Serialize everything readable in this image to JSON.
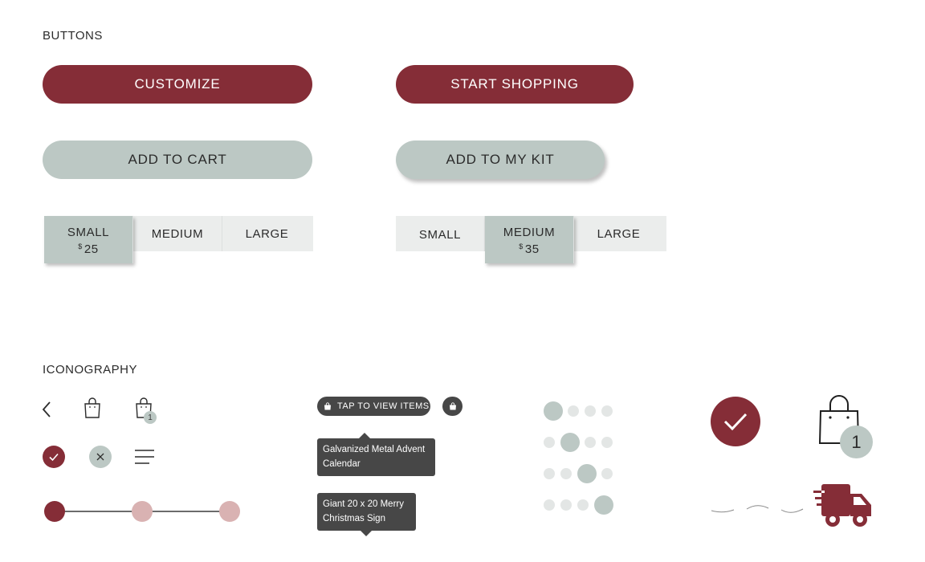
{
  "sections": {
    "buttons_title": "BUTTONS",
    "icons_title": "ICONOGRAPHY"
  },
  "buttons": {
    "customize": "CUSTOMIZE",
    "start_shopping": "START SHOPPING",
    "add_to_cart": "ADD TO CART",
    "add_to_my_kit": "ADD TO MY KIT"
  },
  "size_selector_a": {
    "options": [
      {
        "label": "SMALL",
        "currency": "$",
        "price": "25",
        "selected": true
      },
      {
        "label": "MEDIUM",
        "selected": false
      },
      {
        "label": "LARGE",
        "selected": false
      }
    ]
  },
  "size_selector_b": {
    "options": [
      {
        "label": "SMALL",
        "selected": false
      },
      {
        "label": "MEDIUM",
        "currency": "$",
        "price": "35",
        "selected": true
      },
      {
        "label": "LARGE",
        "selected": false
      }
    ]
  },
  "icons": {
    "bag_badge_small": "1",
    "bag_badge_large": "1",
    "tap_chip": "TAP TO VIEW ITEMS",
    "tooltip_1": "Galvanized Metal Advent Calendar",
    "tooltip_2": "Giant 20 x 20 Merry Christmas Sign",
    "names": [
      "back-chevron-icon",
      "shopping-bag-icon",
      "check-icon",
      "close-icon",
      "menu-icon",
      "delivery-truck-icon"
    ]
  },
  "progress_steps": {
    "total": 3,
    "current": 1
  },
  "carousel_indicators": {
    "total": 4,
    "active_positions": [
      1,
      2,
      3,
      4
    ]
  },
  "colors": {
    "primary": "#852d37",
    "secondary": "#bcc8c4",
    "light_gray": "#ebedec",
    "dark_chip": "#474747",
    "step_inactive": "#d9b2b2",
    "dot_inactive": "#e3e6e5"
  }
}
